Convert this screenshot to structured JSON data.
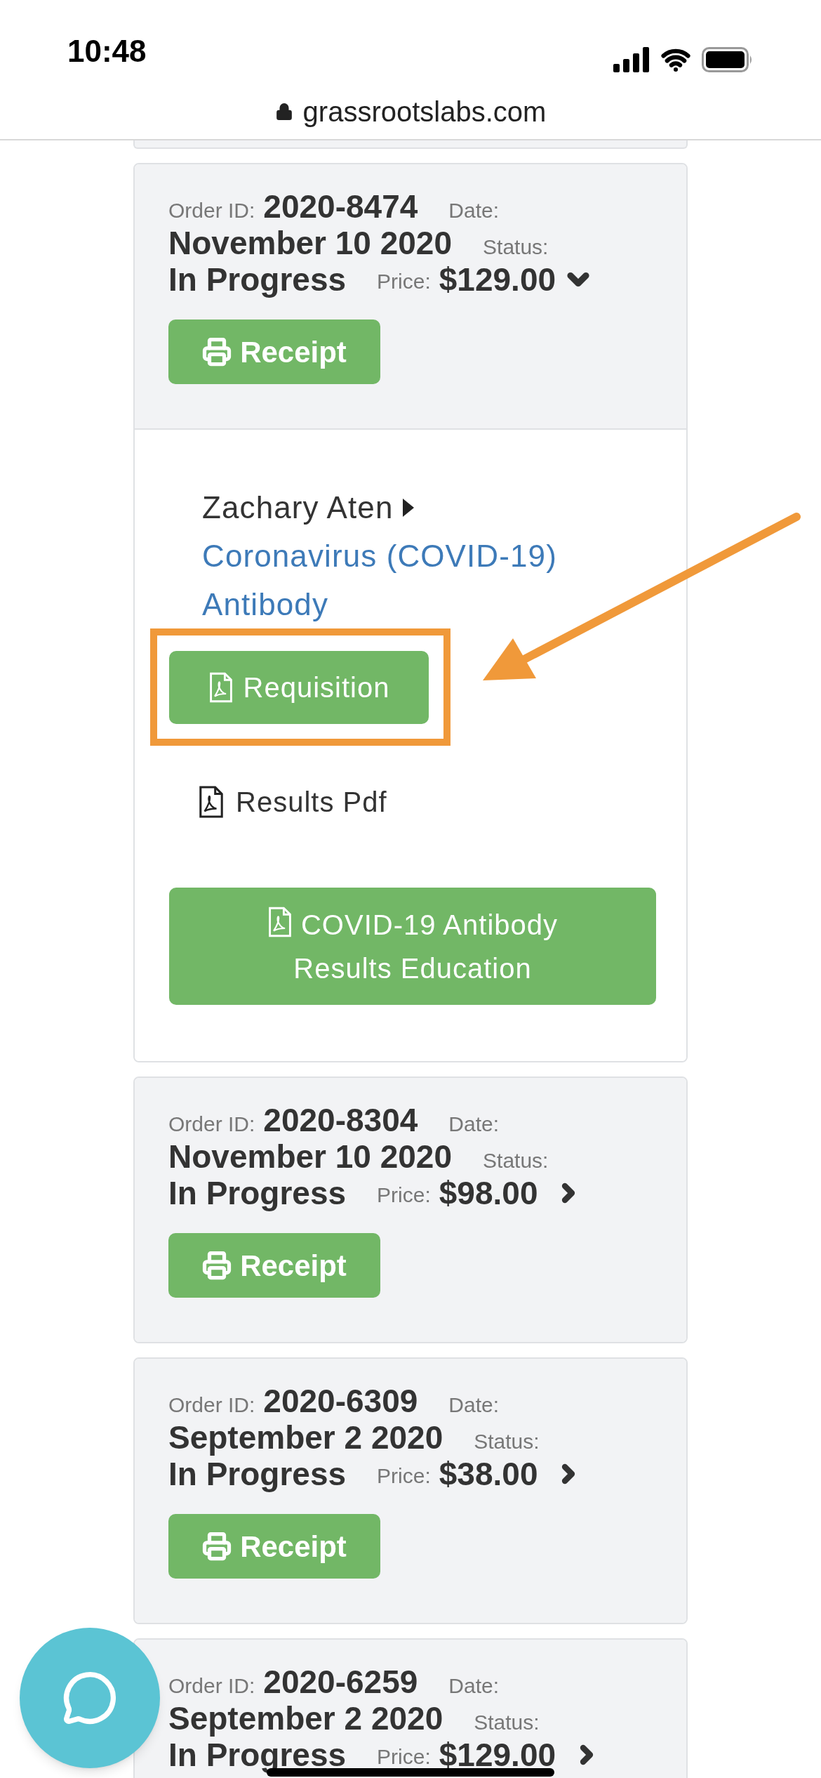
{
  "status_bar": {
    "time": "10:48"
  },
  "browser": {
    "url": "grassrootslabs.com"
  },
  "orders": [
    {
      "order_id_label": "Order ID:",
      "order_id": "2020-8474",
      "date_label": "Date:",
      "date": "November 10 2020",
      "status_label": "Status:",
      "status": "In Progress",
      "price_label": "Price:",
      "price": "$129.00",
      "expanded": true,
      "receipt_button": "Receipt",
      "details": {
        "patient": "Zachary Aten",
        "test_link": "Coronavirus (COVID-19) Antibody",
        "requisition_button": "Requisition",
        "highlighted": true,
        "results_link": "Results Pdf",
        "education_button": "COVID-19 Antibody Results Education"
      }
    },
    {
      "order_id_label": "Order ID:",
      "order_id": "2020-8304",
      "date_label": "Date:",
      "date": "November 10 2020",
      "status_label": "Status:",
      "status": "In Progress",
      "price_label": "Price:",
      "price": "$98.00",
      "expanded": false,
      "receipt_button": "Receipt"
    },
    {
      "order_id_label": "Order ID:",
      "order_id": "2020-6309",
      "date_label": "Date:",
      "date": "September 2 2020",
      "status_label": "Status:",
      "status": "In Progress",
      "price_label": "Price:",
      "price": "$38.00",
      "expanded": false,
      "receipt_button": "Receipt"
    },
    {
      "order_id_label": "Order ID:",
      "order_id": "2020-6259",
      "date_label": "Date:",
      "date": "September 2 2020",
      "status_label": "Status:",
      "status": "In Progress",
      "price_label": "Price:",
      "price": "$129.00",
      "expanded": false
    }
  ]
}
